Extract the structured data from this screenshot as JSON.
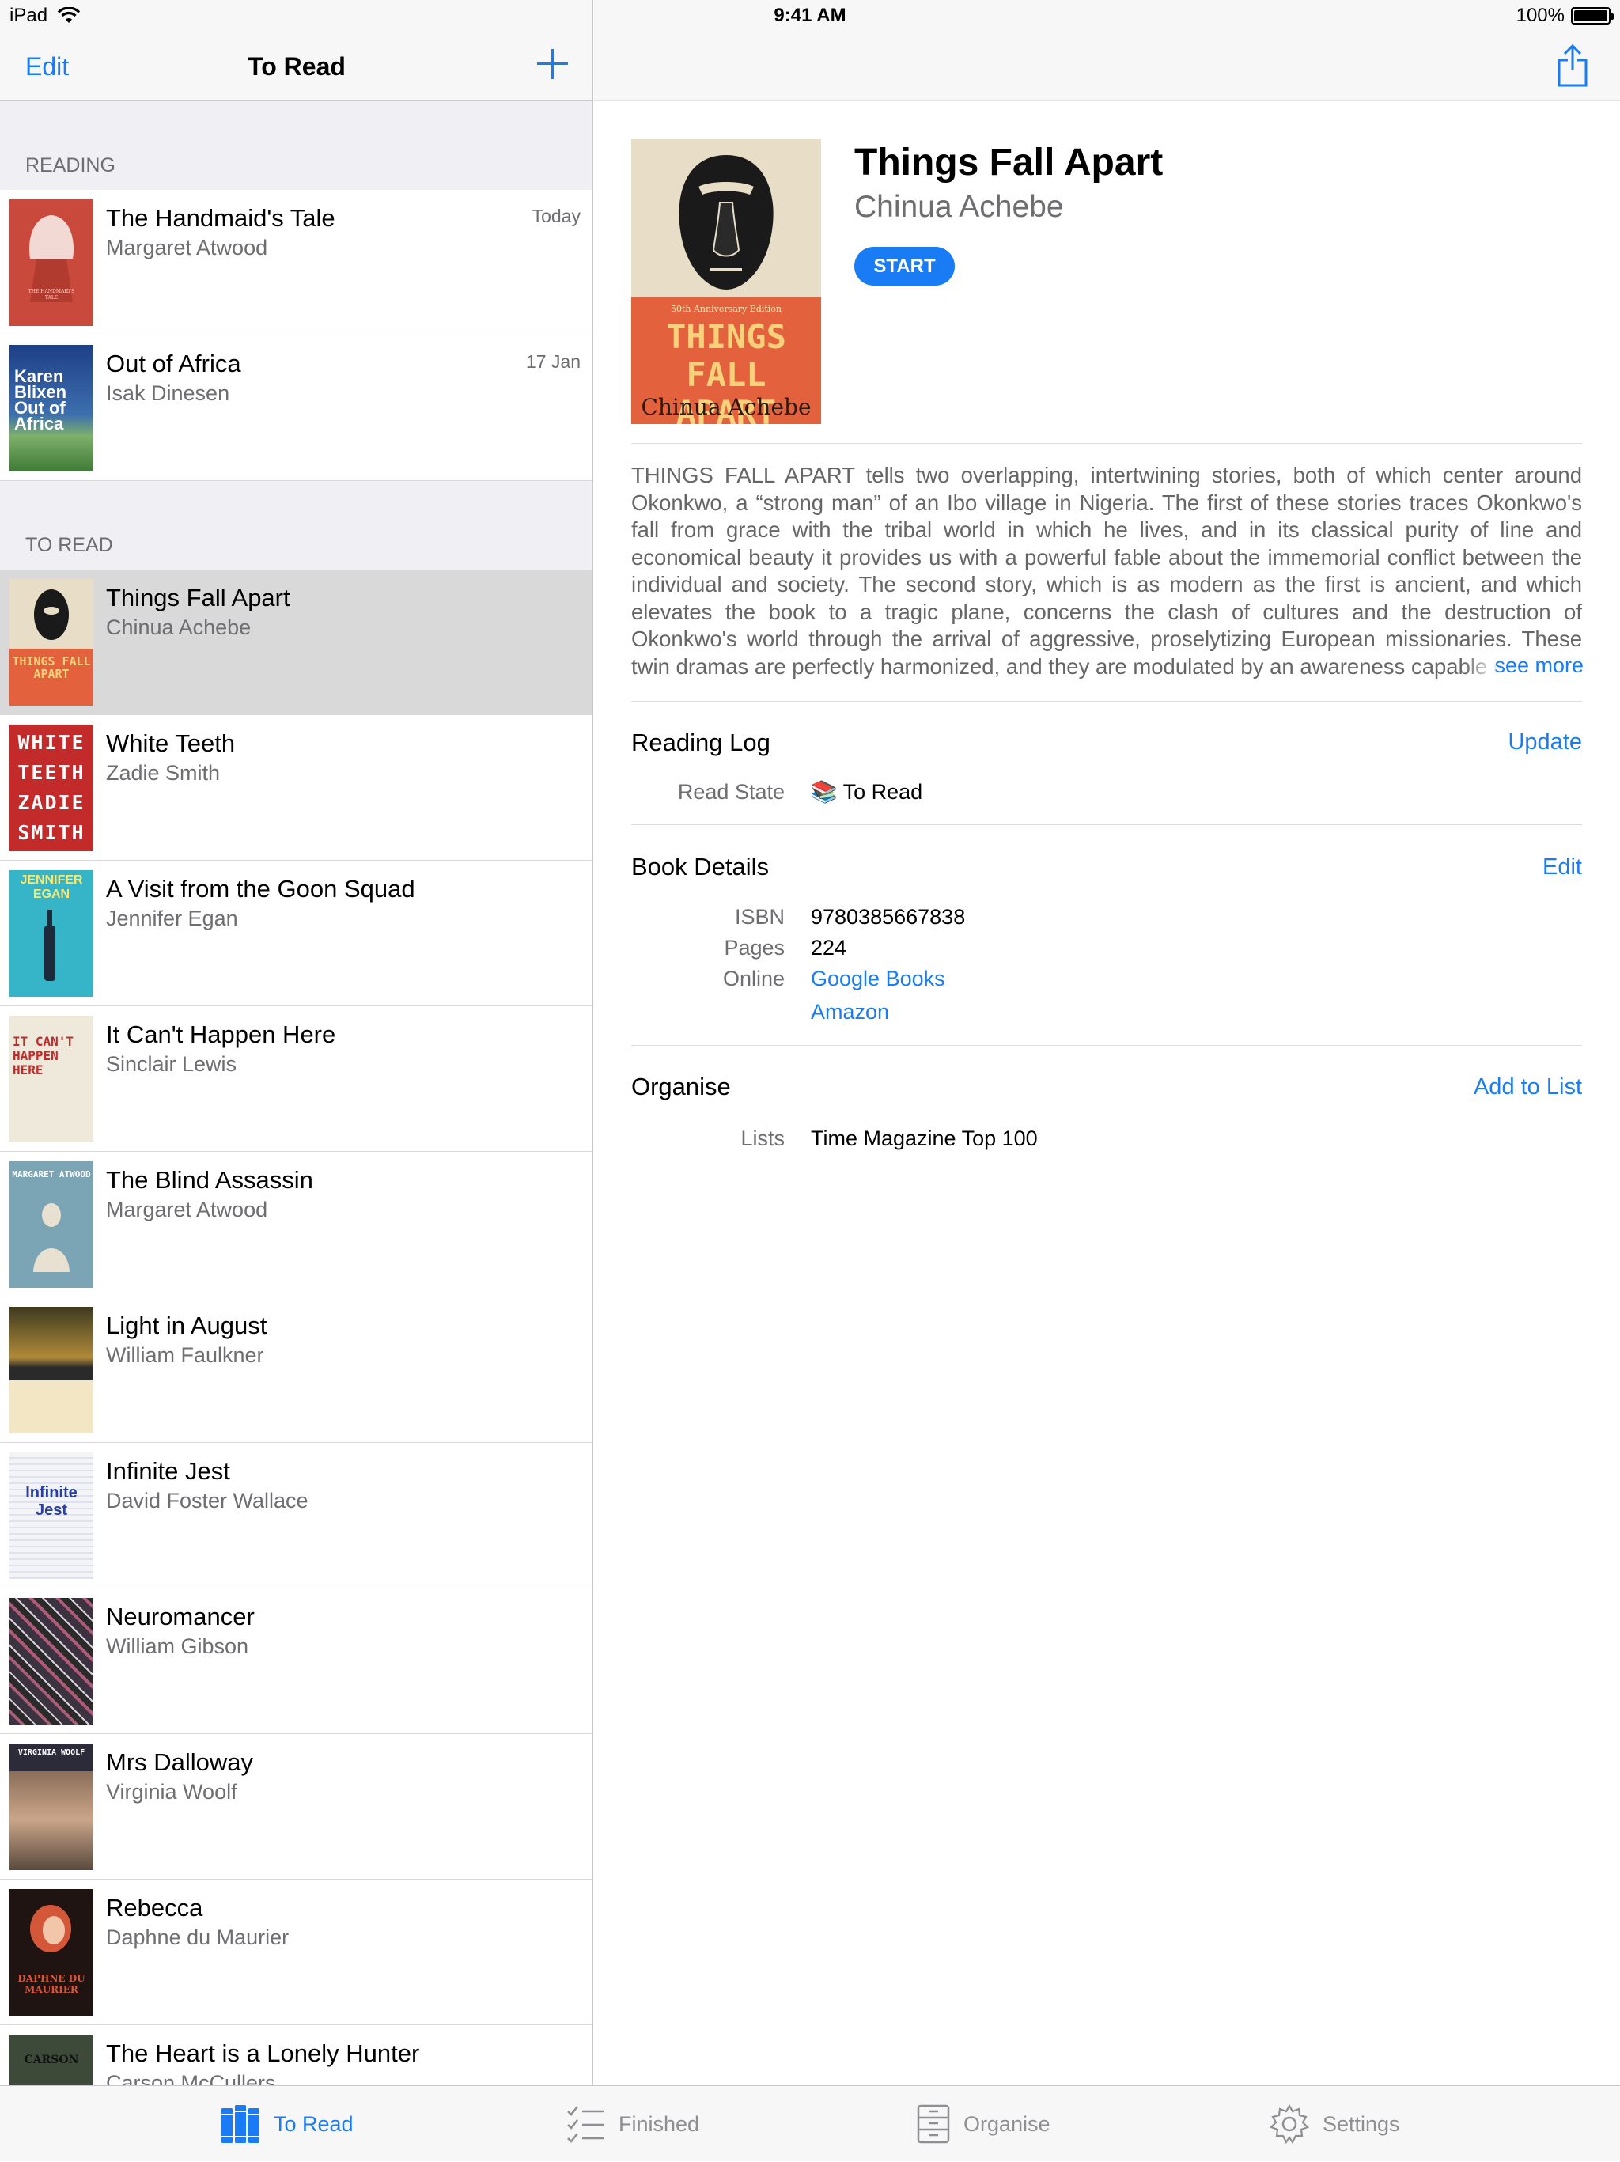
{
  "status_bar": {
    "device": "iPad",
    "time": "9:41 AM",
    "battery": "100%",
    "battery_level": 1.0
  },
  "master": {
    "nav": {
      "edit_label": "Edit",
      "title": "To Read",
      "add_icon": "plus-icon"
    },
    "sections": [
      {
        "header": "READING",
        "books": [
          {
            "title": "The Handmaid's Tale",
            "author": "Margaret Atwood",
            "date": "Today",
            "cover_color": "#c94a3c"
          },
          {
            "title": "Out of Africa",
            "author": "Isak Dinesen",
            "date": "17 Jan",
            "cover_color": "#3d6fae",
            "cover_text": "Karen Blixen Out of Africa"
          }
        ]
      },
      {
        "header": "TO READ",
        "books": [
          {
            "title": "Things Fall Apart",
            "author": "Chinua Achebe",
            "cover_color": "#e4613d",
            "cover_text": "THINGS FALL APART"
          },
          {
            "title": "White Teeth",
            "author": "Zadie Smith",
            "cover_color": "#c32a2a",
            "cover_text": "WHITE TEETH ZADIE SMITH"
          },
          {
            "title": "A Visit from the Goon Squad",
            "author": "Jennifer Egan",
            "cover_color": "#35b5c7",
            "cover_text": "JENNIFER EGAN"
          },
          {
            "title": "It Can't Happen Here",
            "author": "Sinclair Lewis",
            "cover_color": "#efe9dc",
            "cover_text": "IT CAN'T HAPPEN HERE"
          },
          {
            "title": "The Blind Assassin",
            "author": "Margaret Atwood",
            "cover_color": "#7ba4b4",
            "cover_text": "MARGARET ATWOOD"
          },
          {
            "title": "Light in August",
            "author": "William Faulkner",
            "cover_color": "#8a6a2c"
          },
          {
            "title": "Infinite Jest",
            "author": "David Foster Wallace",
            "cover_color": "#f4f4f6",
            "cover_text": "Infinite Jest"
          },
          {
            "title": "Neuromancer",
            "author": "William Gibson",
            "cover_color": "#3b3340"
          },
          {
            "title": "Mrs Dalloway",
            "author": "Virginia Woolf",
            "cover_color": "#5a4a3d",
            "cover_text": "VIRGINIA WOOLF"
          },
          {
            "title": "Rebecca",
            "author": "Daphne du Maurier",
            "cover_color": "#2b1a18",
            "cover_text": "DAPHNE DU MAURIER"
          },
          {
            "title": "The Heart is a Lonely Hunter",
            "author": "Carson McCullers",
            "cover_color": "#3d4a3a",
            "cover_text": "CARSON"
          }
        ]
      }
    ]
  },
  "detail": {
    "share_icon": "share-icon",
    "title": "Things Fall Apart",
    "author": "Chinua Achebe",
    "start_label": "START",
    "cover_text": "THINGS FALL APART",
    "cover_author": "Chinua Achebe",
    "cover_edition": "50th Anniversary Edition",
    "description": "THINGS FALL APART tells two overlapping, intertwining stories, both of which center around Okonkwo, a “strong man” of an Ibo village in Nigeria. The first of these stories traces Okonkwo's fall from grace with the tribal world in which he lives, and in its classical purity of line and economical beauty it provides us with a powerful fable about the immemorial conflict between the individual and society. The second story, which is as modern as the first is ancient, and which elevates the book to a tragic plane, concerns the clash of cultures and the destruction of Okonkwo's world through the arrival of aggressive, proselytizing European missionaries. These twin dramas are perfectly harmonized, and they are modulated by an awareness capable of",
    "see_more": "see more",
    "reading_log": {
      "title": "Reading Log",
      "action": "Update",
      "read_state_label": "Read State",
      "read_state_value": "📚 To Read"
    },
    "book_details": {
      "title": "Book Details",
      "action": "Edit",
      "isbn_label": "ISBN",
      "isbn": "9780385667838",
      "pages_label": "Pages",
      "pages": "224",
      "online_label": "Online",
      "links": [
        "Google Books",
        "Amazon"
      ]
    },
    "organise": {
      "title": "Organise",
      "action": "Add to List",
      "lists_label": "Lists",
      "lists_value": "Time Magazine Top 100"
    }
  },
  "tab_bar": {
    "tabs": [
      {
        "label": "To Read",
        "icon": "books-icon",
        "active": true
      },
      {
        "label": "Finished",
        "icon": "checklist-icon",
        "active": false
      },
      {
        "label": "Organise",
        "icon": "cabinet-icon",
        "active": false
      },
      {
        "label": "Settings",
        "icon": "gear-icon",
        "active": false
      }
    ]
  },
  "colors": {
    "accent": "#1a7cf4",
    "secondary_text": "#6d6d72",
    "selected_row": "#d9d9d9"
  }
}
